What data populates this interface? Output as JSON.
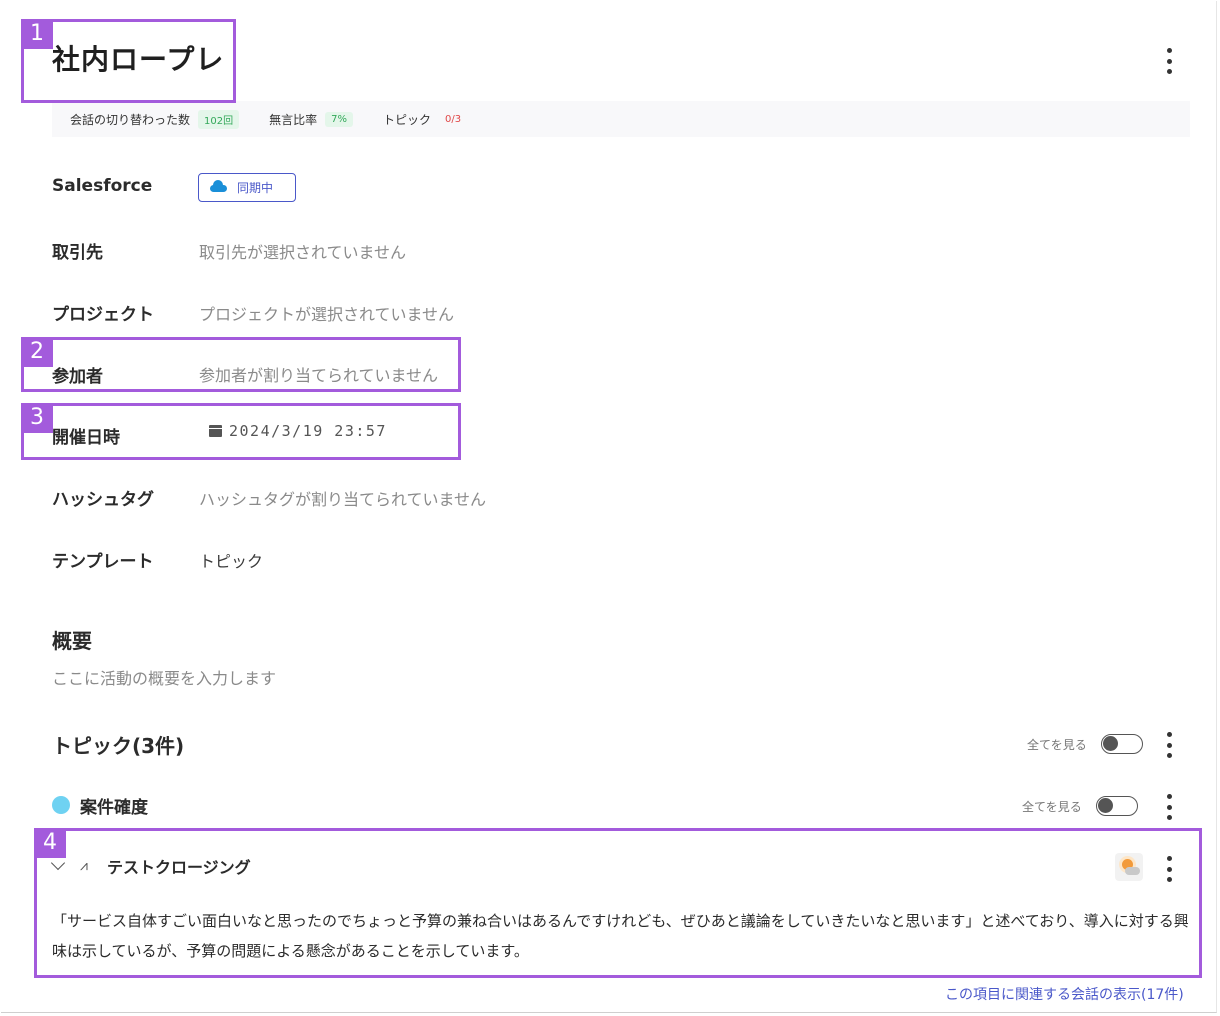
{
  "header": {
    "title": "社内ロープレ"
  },
  "stats": [
    {
      "label": "会話の切り替わった数",
      "value": "102回",
      "tone": "green"
    },
    {
      "label": "無言比率",
      "value": "7%",
      "tone": "green"
    },
    {
      "label": "トピック",
      "value": "0/3",
      "tone": "red"
    }
  ],
  "fields": {
    "salesforce": {
      "label": "Salesforce",
      "badge": "同期中"
    },
    "account": {
      "label": "取引先",
      "value": "取引先が選択されていません"
    },
    "project": {
      "label": "プロジェクト",
      "value": "プロジェクトが選択されていません"
    },
    "participants": {
      "label": "参加者",
      "value": "参加者が割り当てられていません"
    },
    "datetime": {
      "label": "開催日時",
      "value": "2024/3/19 23:57"
    },
    "hashtag": {
      "label": "ハッシュタグ",
      "value": "ハッシュタグが割り当てられていません"
    },
    "template": {
      "label": "テンプレート",
      "value": "トピック"
    }
  },
  "summary": {
    "heading": "概要",
    "placeholder": "ここに活動の概要を入力します"
  },
  "topics": {
    "heading": "トピック(3件)",
    "toggle_label": "全てを見る",
    "group": {
      "name": "案件確度",
      "toggle_label": "全てを見る",
      "dot_color": "#6fd2f2",
      "item": {
        "name": "テストクロージング",
        "description": "「サービス自体すごい面白いなと思ったのでちょっと予算の兼ね合いはあるんですけれども、ぜひあと議論をしていきたいなと思います」と述べており、導入に対する興味は示しているが、予算の問題による懸念があることを示しています。"
      }
    },
    "related_link": "この項目に関連する会話の表示(17件)"
  },
  "callouts": [
    "1",
    "2",
    "3",
    "4"
  ],
  "colors": {
    "accent": "#a35bdc",
    "link": "#4a58c9",
    "salesforce_cloud": "#1a8fd8"
  }
}
